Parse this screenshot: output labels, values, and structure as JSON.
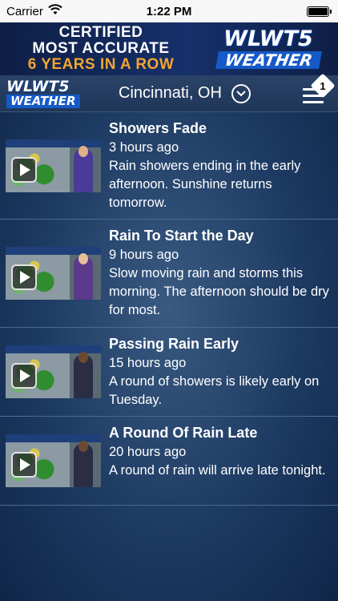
{
  "status_bar": {
    "carrier": "Carrier",
    "time": "1:22 PM",
    "icons": [
      "wifi-icon",
      "battery-icon"
    ]
  },
  "banner": {
    "line1": "CERTIFIED",
    "line2": "MOST ACCURATE",
    "line3": "6 YEARS IN A ROW",
    "logo_top": "WLWT5",
    "logo_bottom": "WEATHER"
  },
  "header": {
    "logo_top": "WLWT5",
    "logo_bottom": "WEATHER",
    "location": "Cincinnati, OH",
    "menu_badge": "1",
    "icons": [
      "chevron-down-icon",
      "menu-icon"
    ]
  },
  "videos": [
    {
      "title": "Showers Fade",
      "time": "3 hours ago",
      "description": "Rain showers ending in the early afternoon. Sunshine returns tomorrow."
    },
    {
      "title": "Rain To Start the Day",
      "time": "9 hours ago",
      "description": "Slow moving rain and storms this morning. The afternoon should be dry for most."
    },
    {
      "title": "Passing Rain Early",
      "time": "15 hours ago",
      "description": "A round of showers is likely early on Tuesday."
    },
    {
      "title": "A Round Of Rain Late",
      "time": "20 hours ago",
      "description": "A round of rain will arrive late tonight."
    }
  ],
  "colors": {
    "accent_orange": "#f2a531",
    "brand_blue": "#1659c8",
    "background": "#1d3a62"
  }
}
